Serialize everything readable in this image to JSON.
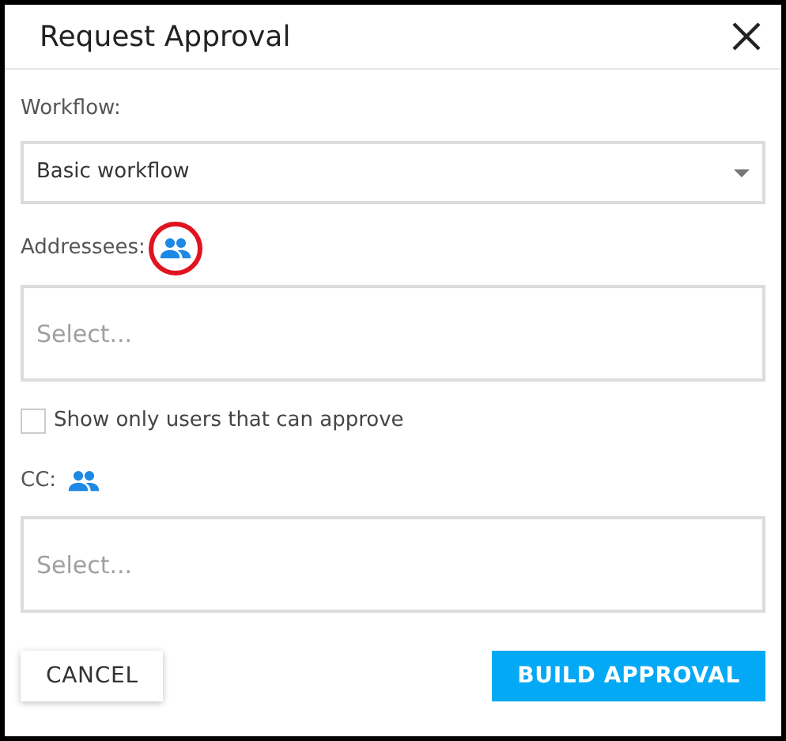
{
  "dialog": {
    "title": "Request Approval"
  },
  "workflow": {
    "label": "Workflow:",
    "value": "Basic workflow"
  },
  "addressees": {
    "label": "Addressees:",
    "placeholder": "Select...",
    "highlighted": true
  },
  "approve_filter": {
    "label": "Show only users that can approve",
    "checked": false
  },
  "cc": {
    "label": "CC:",
    "placeholder": "Select...",
    "highlighted": false
  },
  "buttons": [
    {
      "label": "CANCEL",
      "kind": "secondary"
    },
    {
      "label": "BUILD APPROVAL",
      "kind": "primary"
    }
  ]
}
